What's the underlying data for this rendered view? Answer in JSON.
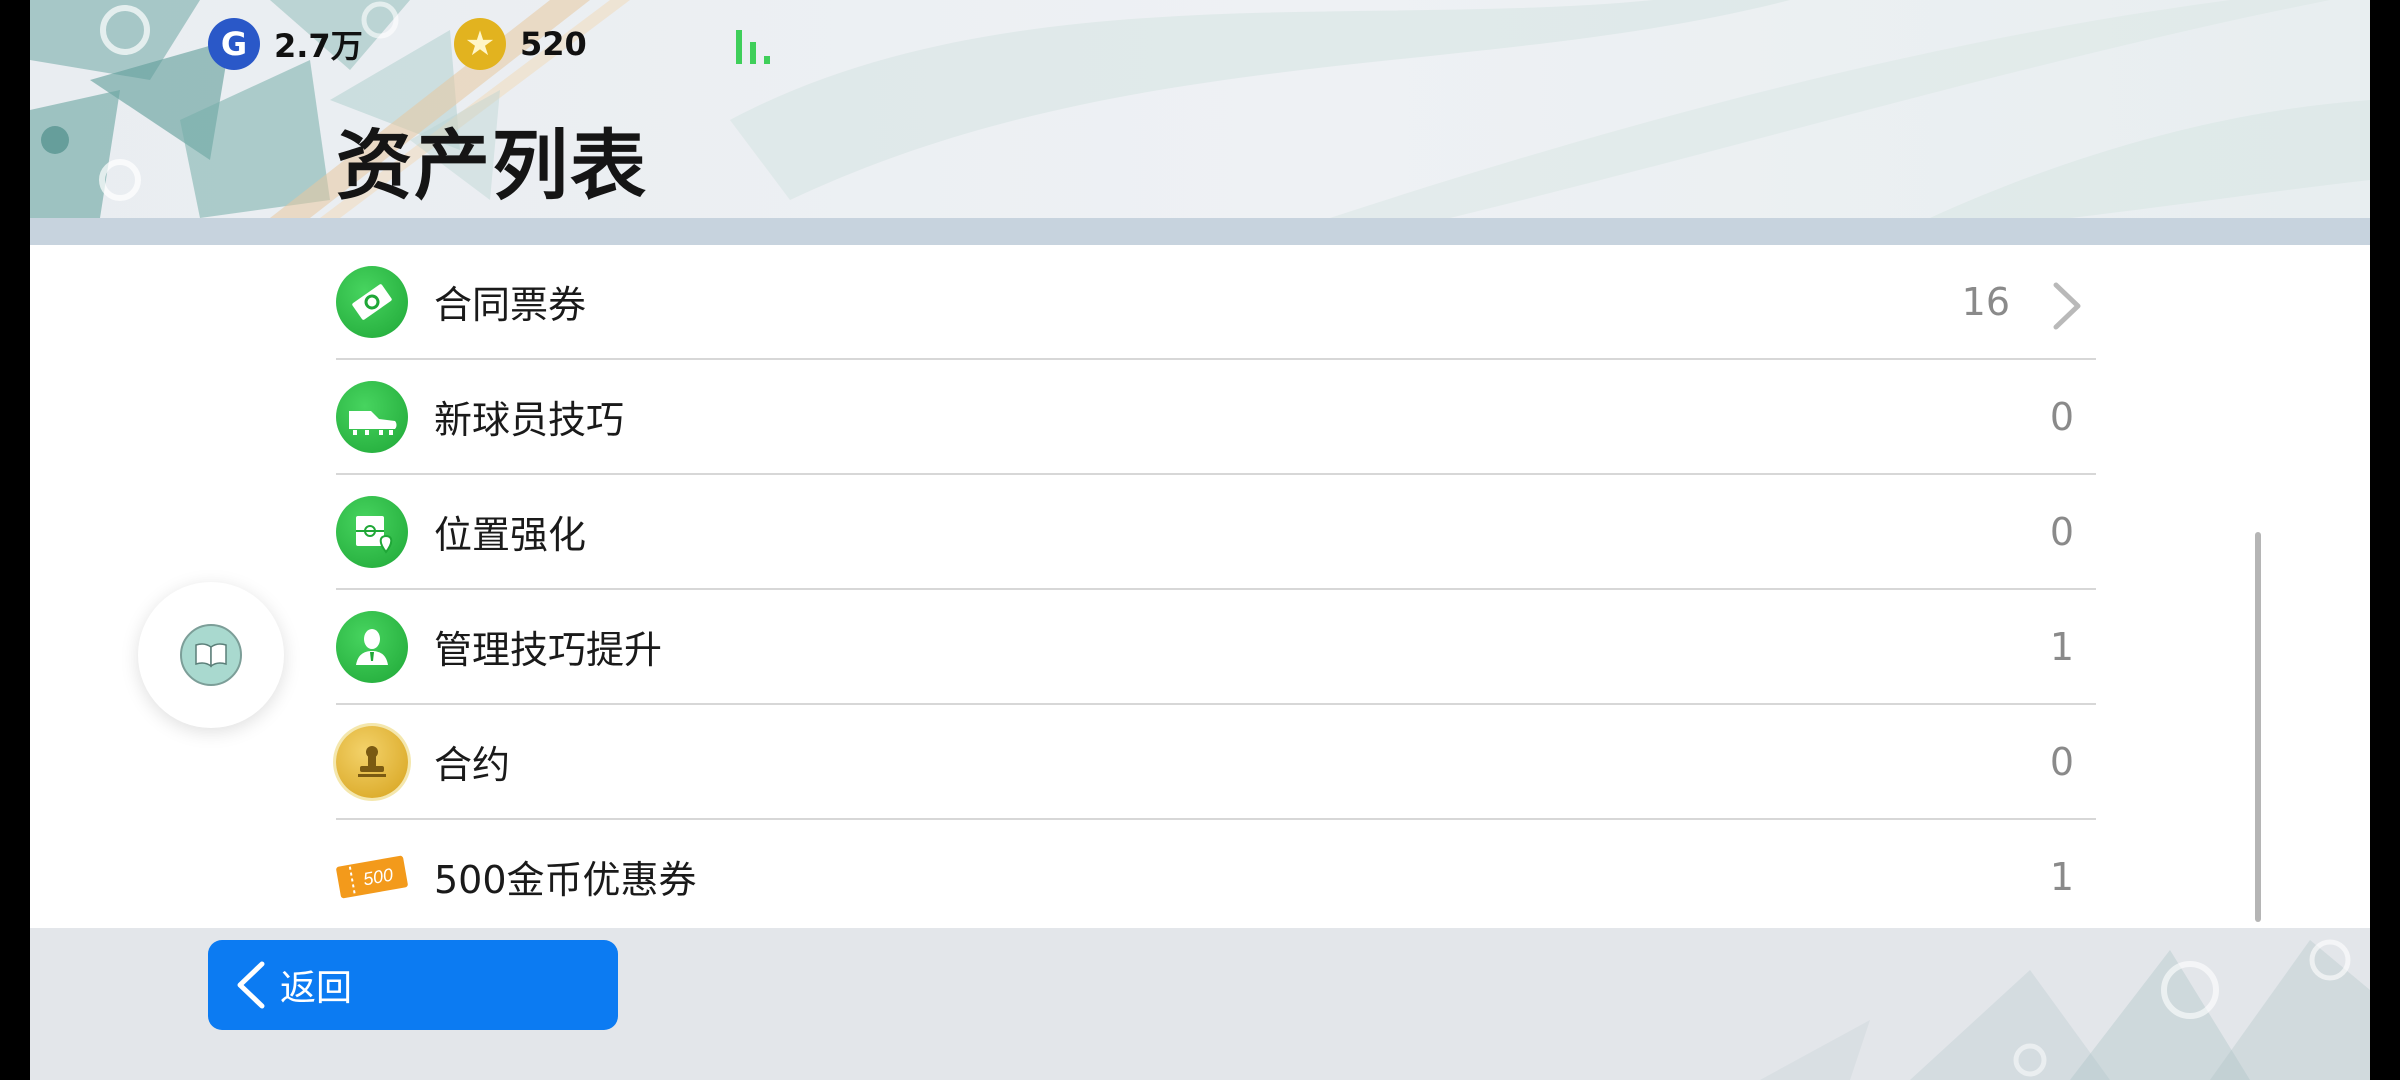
{
  "header": {
    "title": "资产列表",
    "currencies": [
      {
        "icon": "gp-coin-icon",
        "glyph": "G",
        "value": "2.7万",
        "color": "#2a58c8"
      },
      {
        "icon": "star-coin-icon",
        "glyph": "★",
        "value": "520",
        "color": "#e2b31f"
      }
    ],
    "signal_icon": "signal-icon"
  },
  "assets": [
    {
      "label": "合同票券",
      "value": "16",
      "icon": "contract-ticket-icon",
      "has_chevron": true
    },
    {
      "label": "新球员技巧",
      "value": "0",
      "icon": "boot-icon"
    },
    {
      "label": "位置强化",
      "value": "0",
      "icon": "position-map-icon"
    },
    {
      "label": "管理技巧提升",
      "value": "1",
      "icon": "manager-icon"
    },
    {
      "label": "合约",
      "value": "0",
      "icon": "stamp-icon"
    },
    {
      "label": "500金币优惠券",
      "value": "1",
      "icon": "coupon-500-icon",
      "coupon_text": "500"
    }
  ],
  "footer": {
    "back_label": "返回"
  },
  "colors": {
    "accent_blue": "#0c7bf2",
    "icon_green": "#1fa737",
    "gold": "#d6a21c"
  }
}
